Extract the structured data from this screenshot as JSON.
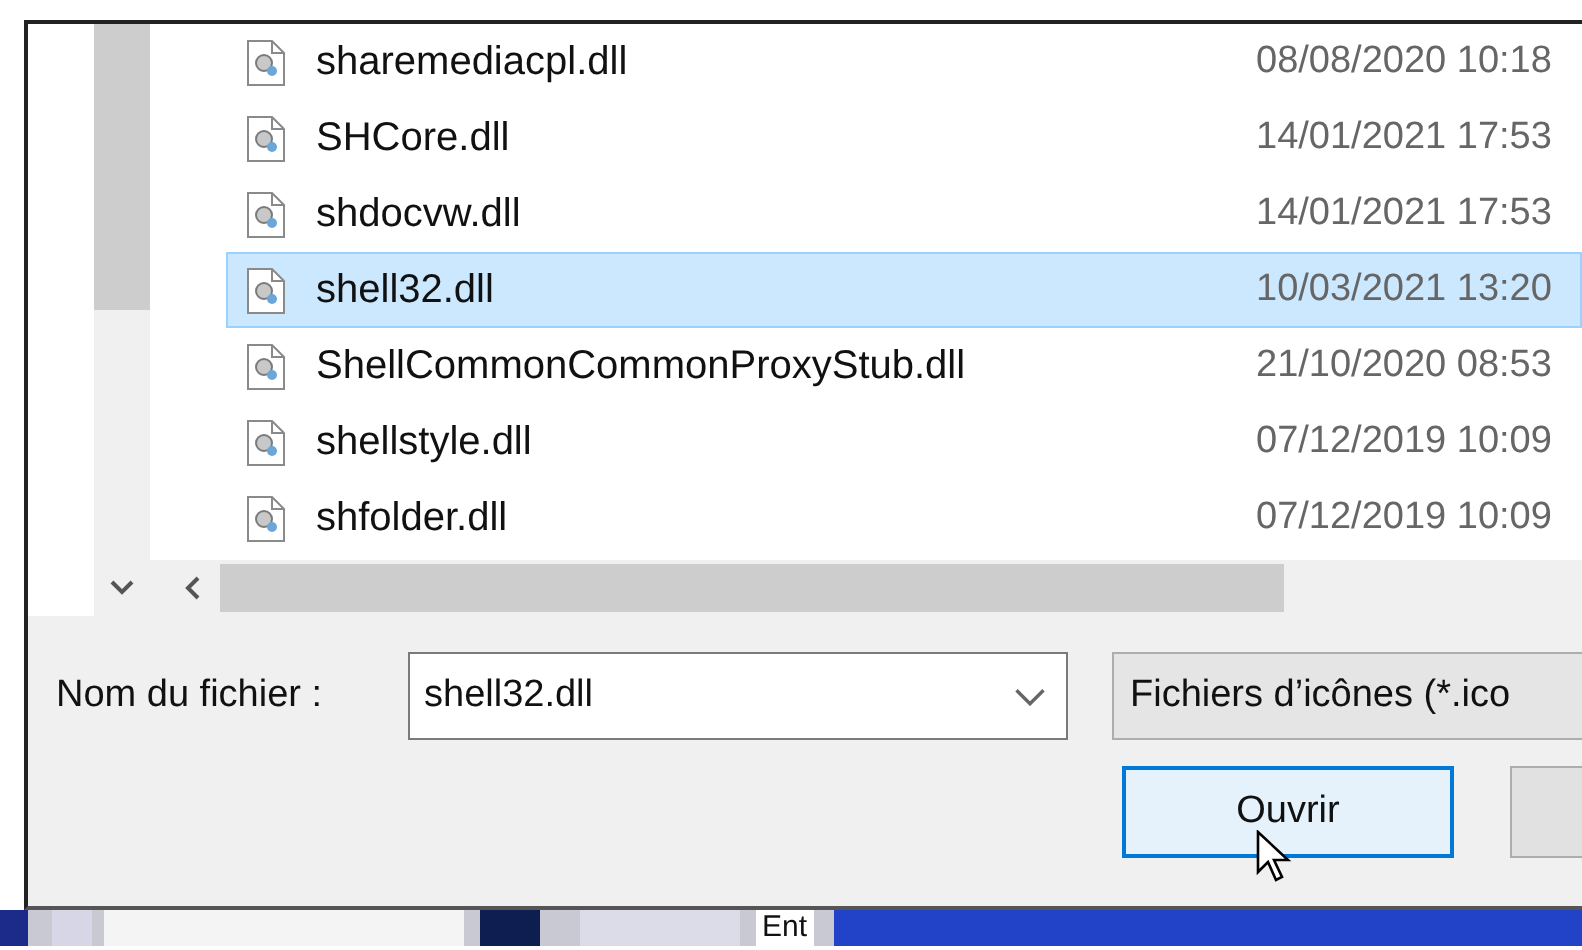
{
  "files": [
    {
      "name": "sharemediacpl.dll",
      "date": "08/08/2020 10:18",
      "selected": false
    },
    {
      "name": "SHCore.dll",
      "date": "14/01/2021 17:53",
      "selected": false
    },
    {
      "name": "shdocvw.dll",
      "date": "14/01/2021 17:53",
      "selected": false
    },
    {
      "name": "shell32.dll",
      "date": "10/03/2021 13:20",
      "selected": true
    },
    {
      "name": "ShellCommonCommonProxyStub.dll",
      "date": "21/10/2020 08:53",
      "selected": false
    },
    {
      "name": "shellstyle.dll",
      "date": "07/12/2019 10:09",
      "selected": false
    },
    {
      "name": "shfolder.dll",
      "date": "07/12/2019 10:09",
      "selected": false
    }
  ],
  "file_name": {
    "label": "Nom du fichier :",
    "value": "shell32.dll"
  },
  "file_type": {
    "value": "Fichiers d’icônes (*.ico"
  },
  "buttons": [
    {
      "label": "Ouvrir"
    }
  ],
  "taskbar": {
    "text": "Ent"
  }
}
